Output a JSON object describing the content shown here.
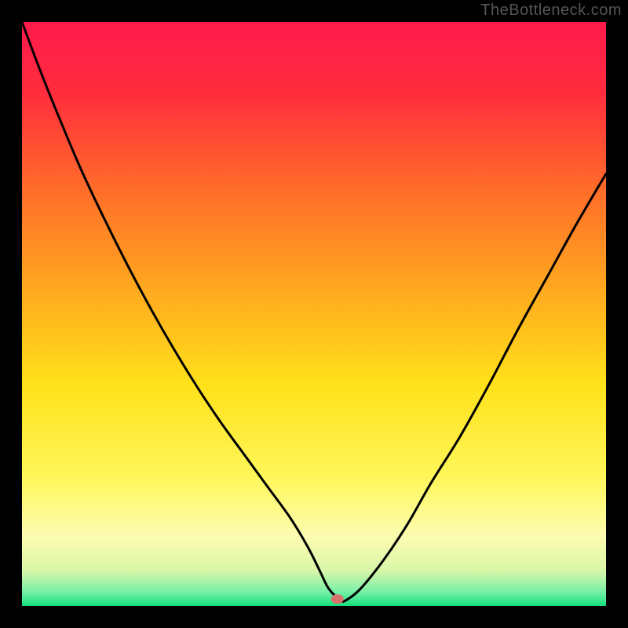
{
  "watermark": "TheBottleneck.com",
  "chart_data": {
    "type": "line",
    "title": "",
    "xlabel": "",
    "ylabel": "",
    "xlim": [
      0,
      100
    ],
    "ylim": [
      0,
      100
    ],
    "background_gradient": {
      "stops": [
        {
          "offset": 0.0,
          "color": "#ff1a4b"
        },
        {
          "offset": 0.12,
          "color": "#ff2c3e"
        },
        {
          "offset": 0.28,
          "color": "#ff6a2a"
        },
        {
          "offset": 0.45,
          "color": "#ffa61f"
        },
        {
          "offset": 0.62,
          "color": "#ffe11a"
        },
        {
          "offset": 0.78,
          "color": "#fff75a"
        },
        {
          "offset": 0.88,
          "color": "#fdfcb0"
        },
        {
          "offset": 0.94,
          "color": "#d8f7a8"
        },
        {
          "offset": 0.975,
          "color": "#7af0a8"
        },
        {
          "offset": 1.0,
          "color": "#15e07e"
        }
      ]
    },
    "series": [
      {
        "name": "bottleneck-curve",
        "x": [
          0,
          3,
          6,
          10,
          14,
          18,
          22,
          26,
          30,
          34,
          38,
          42,
          46,
          49,
          51,
          52.5,
          54.5,
          55.5,
          58,
          62,
          66,
          70,
          75,
          80,
          85,
          90,
          95,
          100
        ],
        "y": [
          100,
          92,
          84.5,
          75,
          66.5,
          58.5,
          51,
          44,
          37.5,
          31.5,
          26,
          20.5,
          15,
          10,
          6,
          3,
          1,
          1,
          3,
          8,
          14,
          21,
          29,
          38,
          47.5,
          56.5,
          65.5,
          74
        ]
      }
    ],
    "marker": {
      "x": 54,
      "y": 1.2,
      "color": "#d9736e"
    }
  }
}
